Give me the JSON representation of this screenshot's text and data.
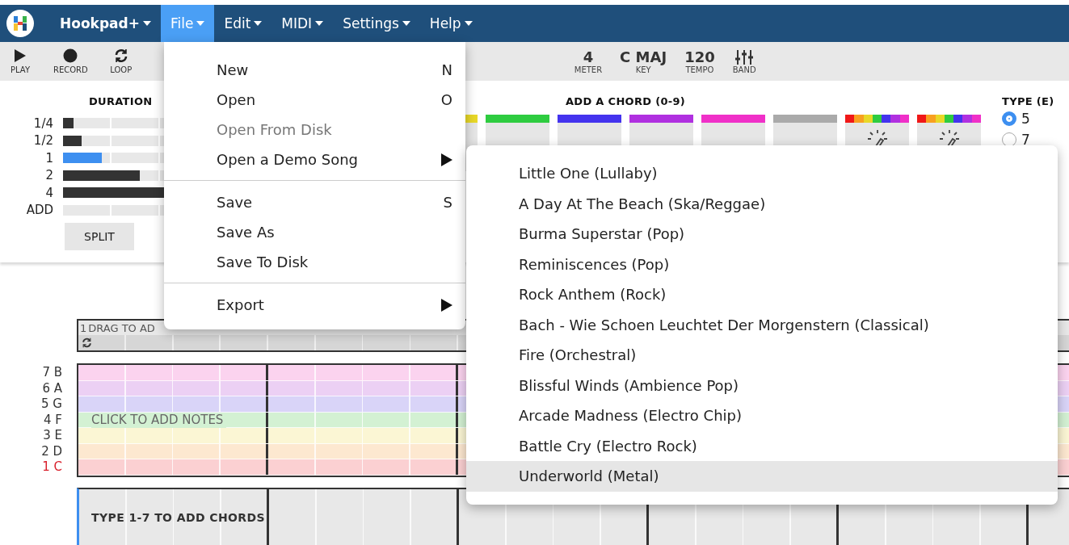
{
  "navbar": {
    "menus": [
      {
        "label": "Hookpad+",
        "selected": false,
        "bold": true
      },
      {
        "label": "File",
        "selected": true,
        "bold": false
      },
      {
        "label": "Edit",
        "selected": false,
        "bold": false
      },
      {
        "label": "MIDI",
        "selected": false,
        "bold": false
      },
      {
        "label": "Settings",
        "selected": false,
        "bold": false
      },
      {
        "label": "Help",
        "selected": false,
        "bold": false
      }
    ]
  },
  "toolbar": {
    "transport": [
      {
        "label": "PLAY",
        "kind": "play"
      },
      {
        "label": "RECORD",
        "kind": "record"
      },
      {
        "label": "LOOP",
        "kind": "loop"
      }
    ],
    "song": [
      {
        "value": "4",
        "label": "METER",
        "kind": "text"
      },
      {
        "value": "C MAJ",
        "label": "KEY",
        "kind": "text"
      },
      {
        "value": "120",
        "label": "TEMPO",
        "kind": "text"
      },
      {
        "label": "BAND",
        "kind": "mixer"
      }
    ]
  },
  "duration": {
    "title": "DURATION",
    "options": [
      {
        "label": "1/4",
        "level": 0.05,
        "selected": false
      },
      {
        "label": "1/2",
        "level": 0.09,
        "selected": false
      },
      {
        "label": "1",
        "level": 0.186,
        "selected": true
      },
      {
        "label": "2",
        "level": 0.37,
        "selected": false
      },
      {
        "label": "4",
        "level": 0.74,
        "selected": false
      }
    ],
    "add_label": "ADD",
    "buttons": [
      "SPLIT"
    ]
  },
  "chords": {
    "title": "ADD A CHORD (0-9)",
    "buttons": [
      {
        "kind": "chord",
        "color": "#e8d828"
      },
      {
        "kind": "chord",
        "color": "#2ecc40"
      },
      {
        "kind": "chord",
        "color": "#4433ee"
      },
      {
        "kind": "chord",
        "color": "#b030e0"
      },
      {
        "kind": "chord",
        "color": "#f030c8"
      },
      {
        "kind": "chord",
        "color": "#aaaaaa"
      },
      {
        "kind": "magic"
      },
      {
        "kind": "magic"
      }
    ]
  },
  "type": {
    "title": "TYPE (E)",
    "options": [
      {
        "label": "5",
        "selected": true
      },
      {
        "label": "7",
        "selected": false
      }
    ]
  },
  "timeline": {
    "measure": "1",
    "hint": "DRAG TO AD"
  },
  "notes": {
    "hint": "CLICK TO ADD NOTES",
    "rows": [
      {
        "degree": "7",
        "note": "B",
        "color": "#fbd3ef",
        "tonic": false
      },
      {
        "degree": "6",
        "note": "A",
        "color": "#ecd0f4",
        "tonic": false
      },
      {
        "degree": "5",
        "note": "G",
        "color": "#d9d4f8",
        "tonic": false
      },
      {
        "degree": "4",
        "note": "F",
        "color": "#d3f1d3",
        "tonic": false
      },
      {
        "degree": "3",
        "note": "E",
        "color": "#fbf6d4",
        "tonic": false
      },
      {
        "degree": "2",
        "note": "D",
        "color": "#fde8d0",
        "tonic": false
      },
      {
        "degree": "1",
        "note": "C",
        "color": "#fbd0d2",
        "tonic": true
      }
    ]
  },
  "chord_track": {
    "hint": "TYPE 1-7 TO ADD CHORDS"
  },
  "file_menu": {
    "items": [
      {
        "kind": "item",
        "label": "New",
        "shortcut": "N",
        "disabled": false,
        "submenu": false
      },
      {
        "kind": "item",
        "label": "Open",
        "shortcut": "O",
        "disabled": false,
        "submenu": false
      },
      {
        "kind": "item",
        "label": "Open From Disk",
        "disabled": true,
        "submenu": false
      },
      {
        "kind": "item",
        "label": "Open a Demo Song",
        "disabled": false,
        "submenu": true
      },
      {
        "kind": "divider"
      },
      {
        "kind": "item",
        "label": "Save",
        "shortcut": "S",
        "disabled": false,
        "submenu": false
      },
      {
        "kind": "item",
        "label": "Save As",
        "disabled": false,
        "submenu": false
      },
      {
        "kind": "item",
        "label": "Save To Disk",
        "disabled": false,
        "submenu": false
      },
      {
        "kind": "divider"
      },
      {
        "kind": "item",
        "label": "Export",
        "disabled": false,
        "submenu": true
      }
    ]
  },
  "demo_menu": {
    "items": [
      {
        "label": "Little One (Lullaby)",
        "selected": false
      },
      {
        "label": "A Day At The Beach (Ska/Reggae)",
        "selected": false
      },
      {
        "label": "Burma Superstar (Pop)",
        "selected": false
      },
      {
        "label": "Reminiscences (Pop)",
        "selected": false
      },
      {
        "label": "Rock Anthem (Rock)",
        "selected": false
      },
      {
        "label": "Bach - Wie Schoen Leuchtet Der Morgenstern (Classical)",
        "selected": false
      },
      {
        "label": "Fire (Orchestral)",
        "selected": false
      },
      {
        "label": "Blissful Winds (Ambience Pop)",
        "selected": false
      },
      {
        "label": "Arcade Madness (Electro Chip)",
        "selected": false
      },
      {
        "label": "Battle Cry (Electro Rock)",
        "selected": false
      },
      {
        "label": "Underworld (Metal)",
        "selected": true
      }
    ]
  }
}
